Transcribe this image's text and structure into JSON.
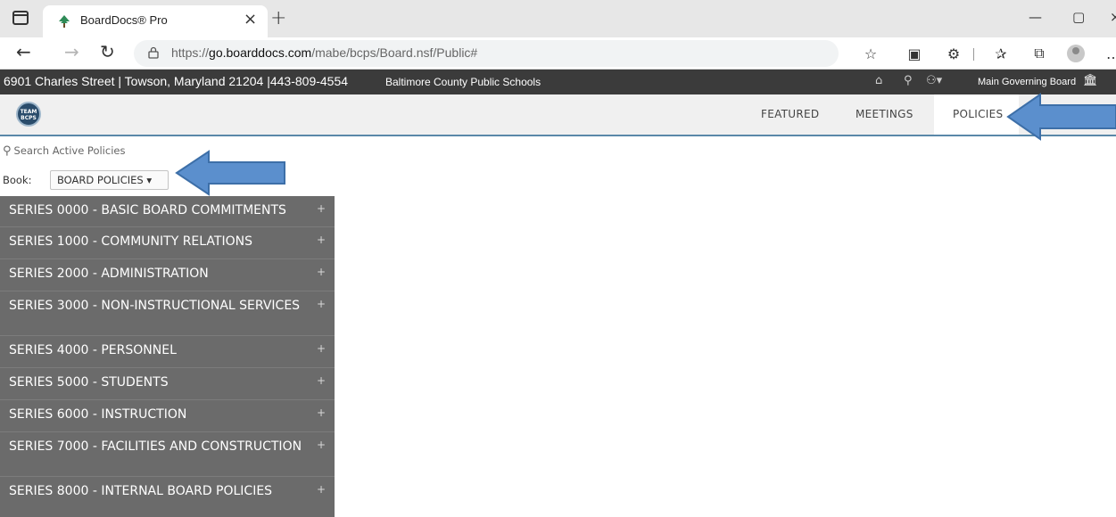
{
  "browser": {
    "tab_title": "BoardDocs® Pro",
    "tab_close": "×",
    "new_tab": "+",
    "url_prefix": "https://",
    "url_host": "go.boarddocs.com",
    "url_path": "/mabe/bcps/Board.nsf/Public#",
    "minimize": "—",
    "restore": "▢",
    "close_partial": "×"
  },
  "site": {
    "address": "6901 Charles Street | Towson, Maryland 21204 |443-809-4554",
    "district": "Baltimore County Public Schools",
    "board_name": "Main Governing Board",
    "logo_text": "TEAM BCPS"
  },
  "nav": {
    "featured": "FEATURED",
    "meetings": "MEETINGS",
    "policies": "POLICIES",
    "active": "POLICIES"
  },
  "panel": {
    "search_placeholder": "Search Active Policies",
    "book_label": "Book:",
    "book_value": "BOARD POLICIES ▾"
  },
  "series": [
    {
      "label": "SERIES 0000 - BASIC BOARD COMMITMENTS",
      "toggle": "+"
    },
    {
      "label": "SERIES 1000 - COMMUNITY RELATIONS",
      "toggle": "+"
    },
    {
      "label": "SERIES 2000 - ADMINISTRATION",
      "toggle": "+"
    },
    {
      "label": "SERIES 3000 - NON-INSTRUCTIONAL SERVICES",
      "toggle": "+"
    },
    {
      "label": "SERIES 4000 - PERSONNEL",
      "toggle": "+"
    },
    {
      "label": "SERIES 5000 - STUDENTS",
      "toggle": "+"
    },
    {
      "label": "SERIES 6000 - INSTRUCTION",
      "toggle": "+"
    },
    {
      "label": "SERIES 7000 - FACILITIES AND CONSTRUCTION",
      "toggle": "+"
    },
    {
      "label": "SERIES 8000 - INTERNAL BOARD POLICIES",
      "toggle": "+"
    }
  ],
  "colors": {
    "panel_bg": "#6b6b6b",
    "header_bg": "#3b3b3b",
    "arrow_fill": "#5b8fcd",
    "arrow_stroke": "#3d6fa8"
  }
}
